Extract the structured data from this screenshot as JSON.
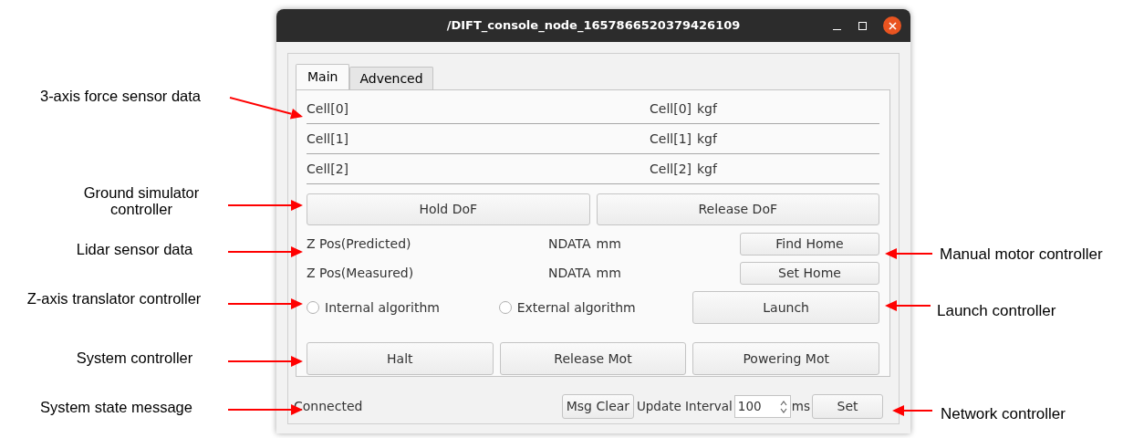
{
  "window": {
    "title": "/DIFT_console_node_1657866520379426109"
  },
  "tabs": [
    {
      "label": "Main",
      "selected": true
    },
    {
      "label": "Advenced",
      "selected": false
    }
  ],
  "sensor_rows": [
    {
      "label": "Cell[0]",
      "value": "Cell[0]",
      "unit": "kgf"
    },
    {
      "label": "Cell[1]",
      "value": "Cell[1]",
      "unit": "kgf"
    },
    {
      "label": "Cell[2]",
      "value": "Cell[2]",
      "unit": "kgf"
    }
  ],
  "dof_buttons": [
    "Hold DoF",
    "Release DoF"
  ],
  "position_rows": [
    {
      "label": "Z Pos(Predicted)",
      "value": "NDATA",
      "unit": "mm",
      "button": "Find Home"
    },
    {
      "label": "Z Pos(Measured)",
      "value": "NDATA",
      "unit": "mm",
      "button": "Set Home"
    }
  ],
  "algorithms": [
    {
      "label": "Internal algorithm",
      "selected": false
    },
    {
      "label": "External algorithm",
      "selected": false
    }
  ],
  "launch_button": "Launch",
  "motor_buttons": [
    "Halt",
    "Release Mot",
    "Powering Mot"
  ],
  "status": {
    "message": "Connected",
    "clear_button": "Msg Clear",
    "interval_label": "Update Interval",
    "interval_value": "100",
    "interval_unit": "ms",
    "set_button": "Set"
  },
  "left_annotations": [
    "3-axis force sensor data",
    "Ground simulator controller",
    "Lidar sensor data",
    "Z-axis translator controller",
    "System controller",
    "System state message"
  ],
  "right_annotations": [
    "Manual motor controller",
    "Launch controller",
    "Network controller"
  ]
}
